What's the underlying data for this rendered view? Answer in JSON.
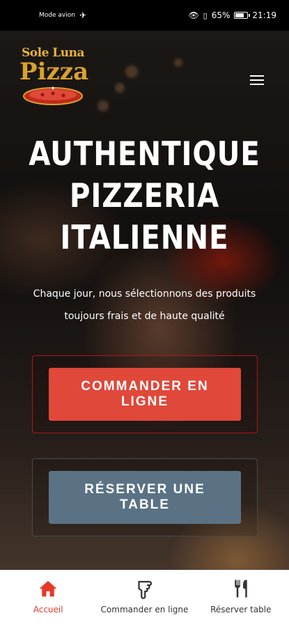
{
  "status_bar": {
    "mode": "Mode avion",
    "battery": "65%",
    "battery_level": 0.65,
    "time": "21:19"
  },
  "brand": {
    "logo_top": "Sole Luna",
    "logo_main": "Pizza"
  },
  "hero": {
    "headline_lines": [
      "AUTHENTIQUE",
      "PIZZERIA",
      "ITALIENNE"
    ],
    "subtitle_lines": [
      "Chaque jour, nous sélectionnons des produits",
      "toujours frais et de haute qualité"
    ]
  },
  "buttons": {
    "order_lines": [
      "COMMANDER EN",
      "LIGNE"
    ],
    "book_lines": [
      "RÉSERVER UNE",
      "TABLE"
    ]
  },
  "bottom_nav": {
    "items": [
      {
        "label": "Accueil",
        "icon": "home-icon",
        "active": true
      },
      {
        "label": "Commander en ligne",
        "icon": "hand-pointer-icon",
        "active": false
      },
      {
        "label": "Réserver table",
        "icon": "utensils-icon",
        "active": false
      }
    ]
  },
  "colors": {
    "accent_red": "#e0483a",
    "button_blue": "#5a7284",
    "active_nav": "#e53929",
    "logo_gold": "#d9a22c"
  }
}
